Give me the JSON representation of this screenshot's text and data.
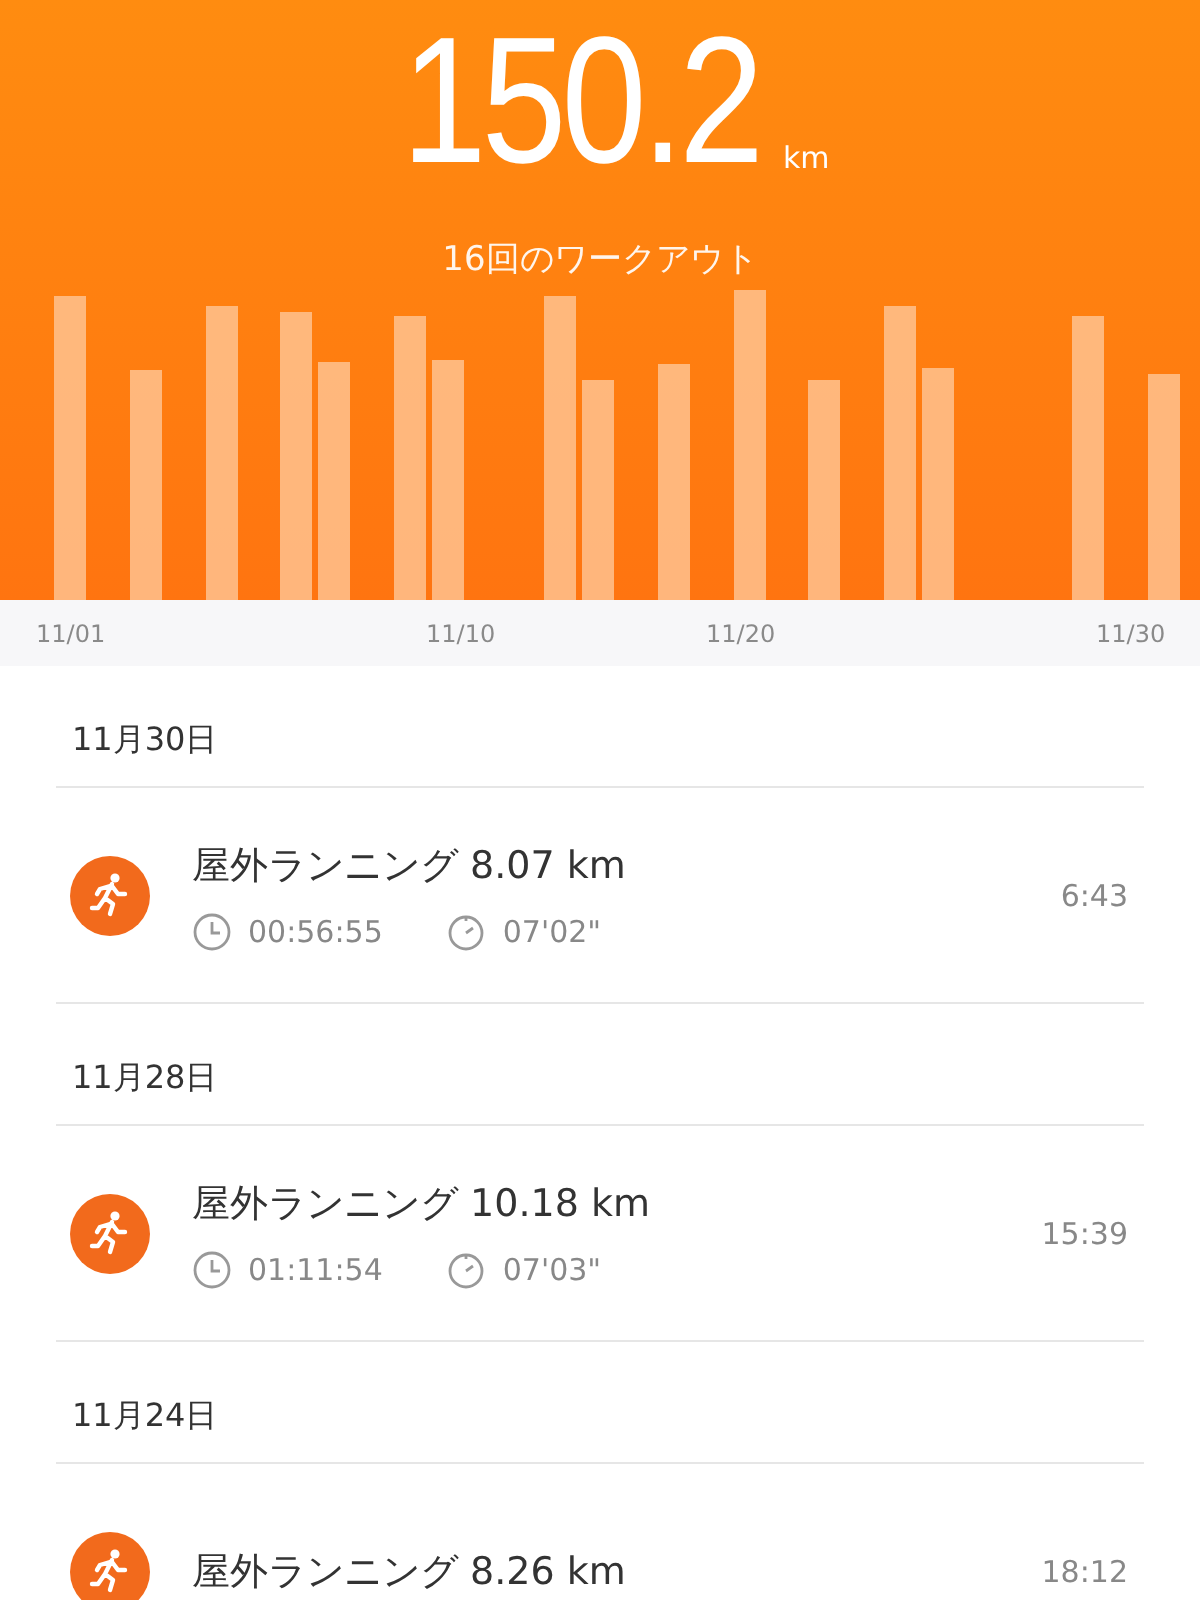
{
  "summary": {
    "distance": "150.2",
    "unit": "km",
    "workouts": "16回のワークアウト"
  },
  "axis_labels": [
    "11/01",
    "11/10",
    "11/20",
    "11/30"
  ],
  "days": [
    {
      "date": "11月30日",
      "workouts": [
        {
          "kind": "running",
          "title": "屋外ランニング 8.07 km",
          "duration": "00:56:55",
          "pace": "07'02\"",
          "time": "6:43"
        }
      ]
    },
    {
      "date": "11月28日",
      "workouts": [
        {
          "kind": "running",
          "title": "屋外ランニング 10.18 km",
          "duration": "01:11:54",
          "pace": "07'03\"",
          "time": "15:39"
        }
      ]
    },
    {
      "date": "11月24日",
      "workouts": [
        {
          "kind": "running",
          "title": "屋外ランニング 8.26 km",
          "time": "18:12"
        }
      ]
    }
  ]
}
